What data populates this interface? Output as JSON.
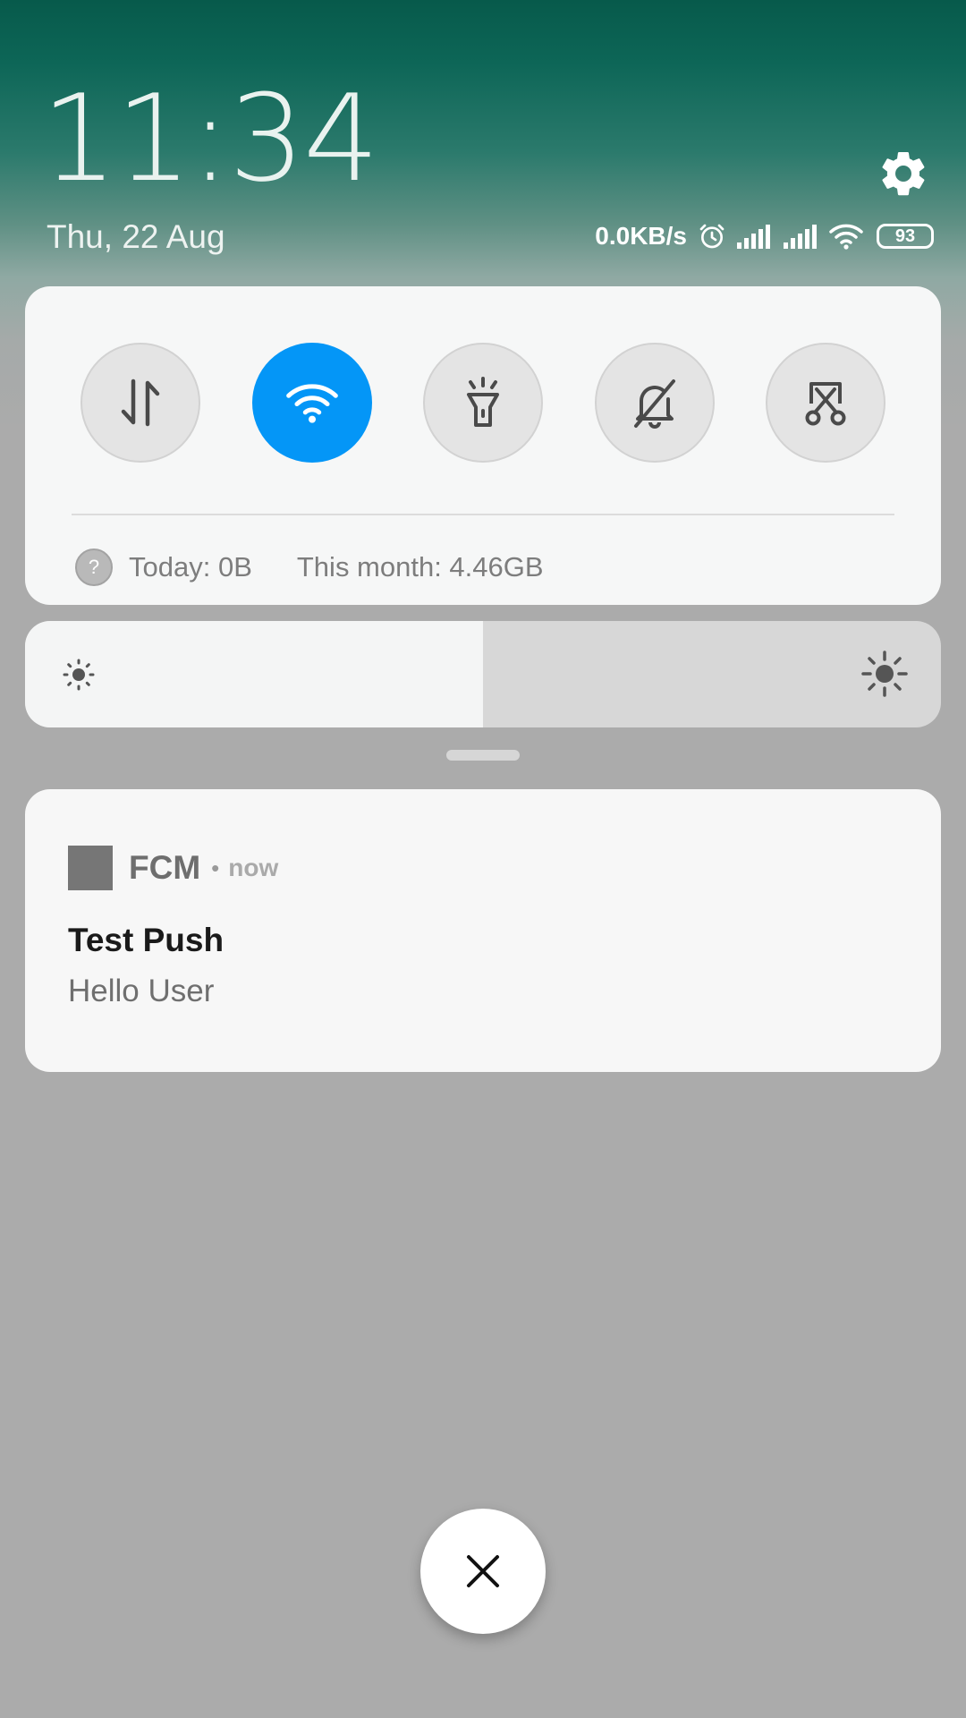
{
  "header": {
    "clock": "11:34",
    "date": "Thu, 22 Aug"
  },
  "status_bar": {
    "net_speed": "0.0KB/s",
    "icons": [
      "alarm-icon",
      "signal-1-icon",
      "signal-2-icon",
      "wifi-icon"
    ],
    "battery": "93"
  },
  "quick_settings": {
    "toggles": [
      {
        "name": "mobile-data",
        "icon": "data-transfer-icon",
        "active": false
      },
      {
        "name": "wifi",
        "icon": "wifi-icon",
        "active": true
      },
      {
        "name": "flashlight",
        "icon": "flashlight-icon",
        "active": false
      },
      {
        "name": "silent",
        "icon": "bell-off-icon",
        "active": false
      },
      {
        "name": "screenshot",
        "icon": "scissors-icon",
        "active": false
      }
    ],
    "usage_today": "Today: 0B",
    "usage_month": "This month: 4.46GB"
  },
  "brightness": {
    "level_fraction": 0.5
  },
  "notification": {
    "app_name": "FCM",
    "separator": "•",
    "time": "now",
    "title": "Test Push",
    "body": "Hello User"
  },
  "colors": {
    "accent": "#0496f7",
    "panel": "#f6f7f7",
    "background": "#ababab"
  }
}
